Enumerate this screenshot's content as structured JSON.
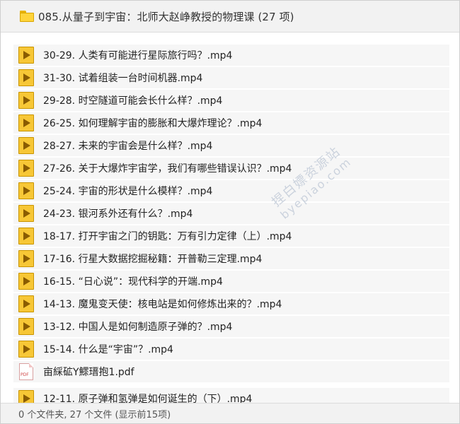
{
  "header": {
    "title": "085.从量子到宇宙：北师大赵峥教授的物理课 (27 项)",
    "icon": "folder-icon"
  },
  "files": [
    {
      "name": "30-29. 人类有可能进行星际旅行吗？.mp4",
      "icon": "media-file-icon"
    },
    {
      "name": "31-30. 试着组装一台时间机器.mp4",
      "icon": "media-file-icon"
    },
    {
      "name": "29-28. 时空隧道可能会长什么样？.mp4",
      "icon": "media-file-icon"
    },
    {
      "name": "26-25. 如何理解宇宙的膨胀和大爆炸理论？.mp4",
      "icon": "media-file-icon"
    },
    {
      "name": "28-27. 未来的宇宙会是什么样？.mp4",
      "icon": "media-file-icon"
    },
    {
      "name": "27-26. 关于大爆炸宇宙学，我们有哪些错误认识？.mp4",
      "icon": "media-file-icon"
    },
    {
      "name": "25-24. 宇宙的形状是什么模样？.mp4",
      "icon": "media-file-icon"
    },
    {
      "name": "24-23. 银河系外还有什么？.mp4",
      "icon": "media-file-icon"
    },
    {
      "name": "18-17. 打开宇宙之门的钥匙：万有引力定律（上）.mp4",
      "icon": "media-file-icon"
    },
    {
      "name": "17-16. 行星大数据挖掘秘籍：开普勒三定理.mp4",
      "icon": "media-file-icon"
    },
    {
      "name": "16-15. “日心说”：现代科学的开端.mp4",
      "icon": "media-file-icon"
    },
    {
      "name": "14-13. 魔鬼变天使：核电站是如何修炼出来的？.mp4",
      "icon": "media-file-icon"
    },
    {
      "name": "13-12. 中国人是如何制造原子弹的？.mp4",
      "icon": "media-file-icon"
    },
    {
      "name": "15-14. 什么是“宇宙”？.mp4",
      "icon": "media-file-icon"
    },
    {
      "name": "亩綵砿Y鰥瑨抱1.pdf",
      "icon": "pdf-file-icon",
      "badge": "PDF"
    },
    {
      "name": "12-11. 原子弹和氢弹是如何诞生的（下）.mp4",
      "icon": "media-file-icon"
    }
  ],
  "watermark": {
    "line1": "捏白嫖资源站",
    "line2": "byepiao.com"
  },
  "footer": {
    "status": "0 个文件夹, 27 个文件 (显示前15项)"
  }
}
